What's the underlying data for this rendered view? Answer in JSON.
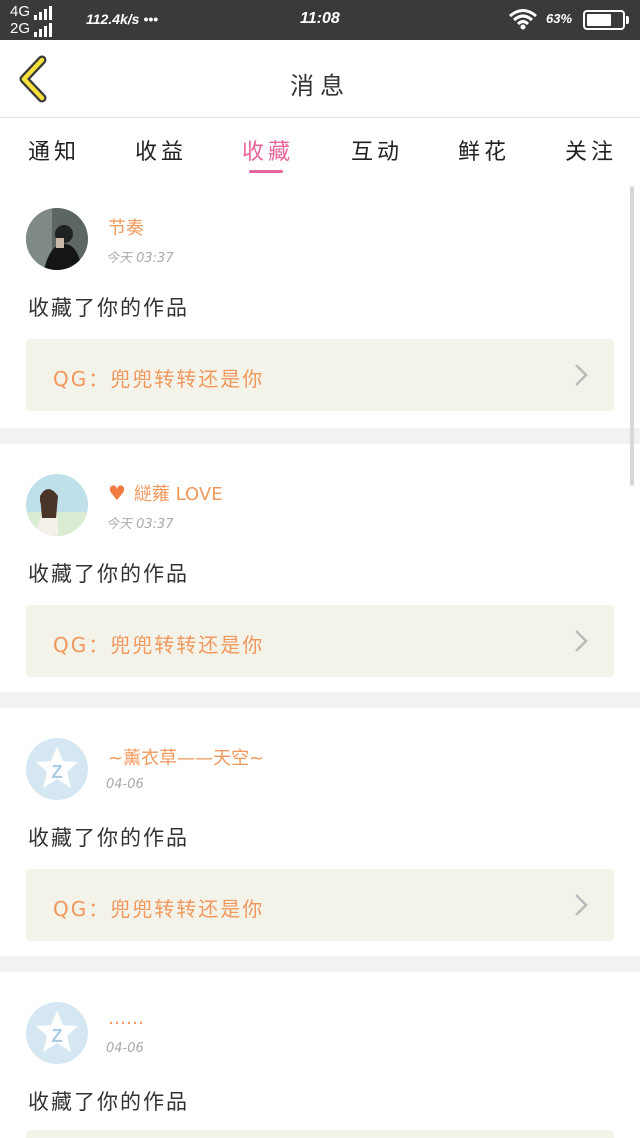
{
  "status_bar": {
    "net_top": "4G",
    "net_bottom": "2G",
    "speed": "112.4k/s •••",
    "time": "11:08",
    "battery": "63%"
  },
  "header": {
    "back_icon": "chevron-left-icon",
    "title": "消息"
  },
  "tabs": [
    {
      "label": "通知"
    },
    {
      "label": "收益"
    },
    {
      "label": "收藏",
      "active": true
    },
    {
      "label": "互动"
    },
    {
      "label": "鲜花"
    },
    {
      "label": "关注"
    }
  ],
  "colors": {
    "accent_pink": "#e8669c",
    "name_orange": "#f0985c",
    "work_bg": "#f4f3ea"
  },
  "feed": {
    "items": [
      {
        "name": "节奏",
        "time": "今天 03:37",
        "action": "收藏了你的作品",
        "work": "QG：兜兜转转还是你",
        "avatar": "photo-dark"
      },
      {
        "name": "縌蕹 LOVE",
        "heart": "♥",
        "time": "今天 03:37",
        "action": "收藏了你的作品",
        "work": "QG：兜兜转转还是你",
        "avatar": "photo-light"
      },
      {
        "name": "~薰衣草——天空~",
        "time": "04-06",
        "action": "收藏了你的作品",
        "work": "QG：兜兜转转还是你",
        "avatar": "qzone-default"
      },
      {
        "name": "……",
        "time": "04-06",
        "action": "收藏了你的作品",
        "work": "",
        "avatar": "qzone-default"
      }
    ]
  }
}
